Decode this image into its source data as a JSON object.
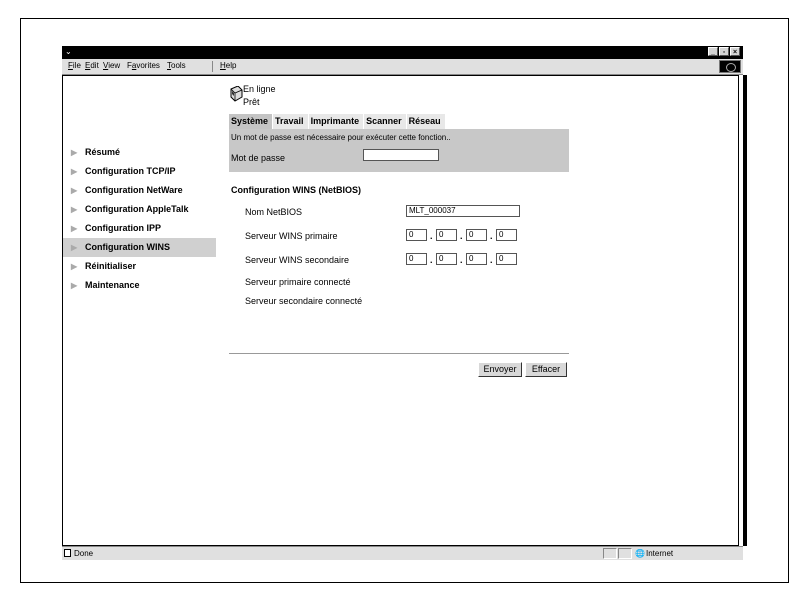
{
  "window": {
    "menu": [
      {
        "name": "file",
        "label": "File",
        "mnemonic": "F",
        "rest": "ile"
      },
      {
        "name": "edit",
        "label": "Edit",
        "mnemonic": "E",
        "rest": "dit"
      },
      {
        "name": "view",
        "label": "View",
        "mnemonic": "V",
        "rest": "iew"
      },
      {
        "name": "favorites",
        "label": "Favorites",
        "mnemonic": "a",
        "pre": "F",
        "rest": "vorites"
      },
      {
        "name": "tools",
        "label": "Tools",
        "mnemonic": "T",
        "rest": "ools"
      },
      {
        "name": "help",
        "label": "Help",
        "mnemonic": "H",
        "rest": "elp"
      }
    ],
    "status_text": "Done",
    "zone_text": "Internet"
  },
  "printer": {
    "status_online": "En ligne",
    "status_ready": "Prêt"
  },
  "tabs": [
    "Système",
    "Travail",
    "Imprimante",
    "Scanner",
    "Réseau"
  ],
  "sidebar": {
    "items": [
      "Résumé",
      "Configuration TCP/IP",
      "Configuration NetWare",
      "Configuration AppleTalk",
      "Configuration IPP",
      "Configuration WINS",
      "Réinitialiser",
      "Maintenance"
    ],
    "active_index": 5
  },
  "password": {
    "message": "Un mot de passe est nécessaire pour exécuter cette fonction..",
    "label": "Mot de passe",
    "value": ""
  },
  "wins": {
    "section_title": "Configuration WINS (NetBIOS)",
    "netbios_label": "Nom NetBIOS",
    "netbios_value": "MLT_000037",
    "primary_label": "Serveur WINS primaire",
    "primary_ip": [
      "0",
      "0",
      "0",
      "0"
    ],
    "secondary_label": "Serveur WINS secondaire",
    "secondary_ip": [
      "0",
      "0",
      "0",
      "0"
    ],
    "primary_connected_label": "Serveur primaire connecté",
    "secondary_connected_label": "Serveur secondaire connecté"
  },
  "buttons": {
    "submit": "Envoyer",
    "clear": "Effacer"
  }
}
